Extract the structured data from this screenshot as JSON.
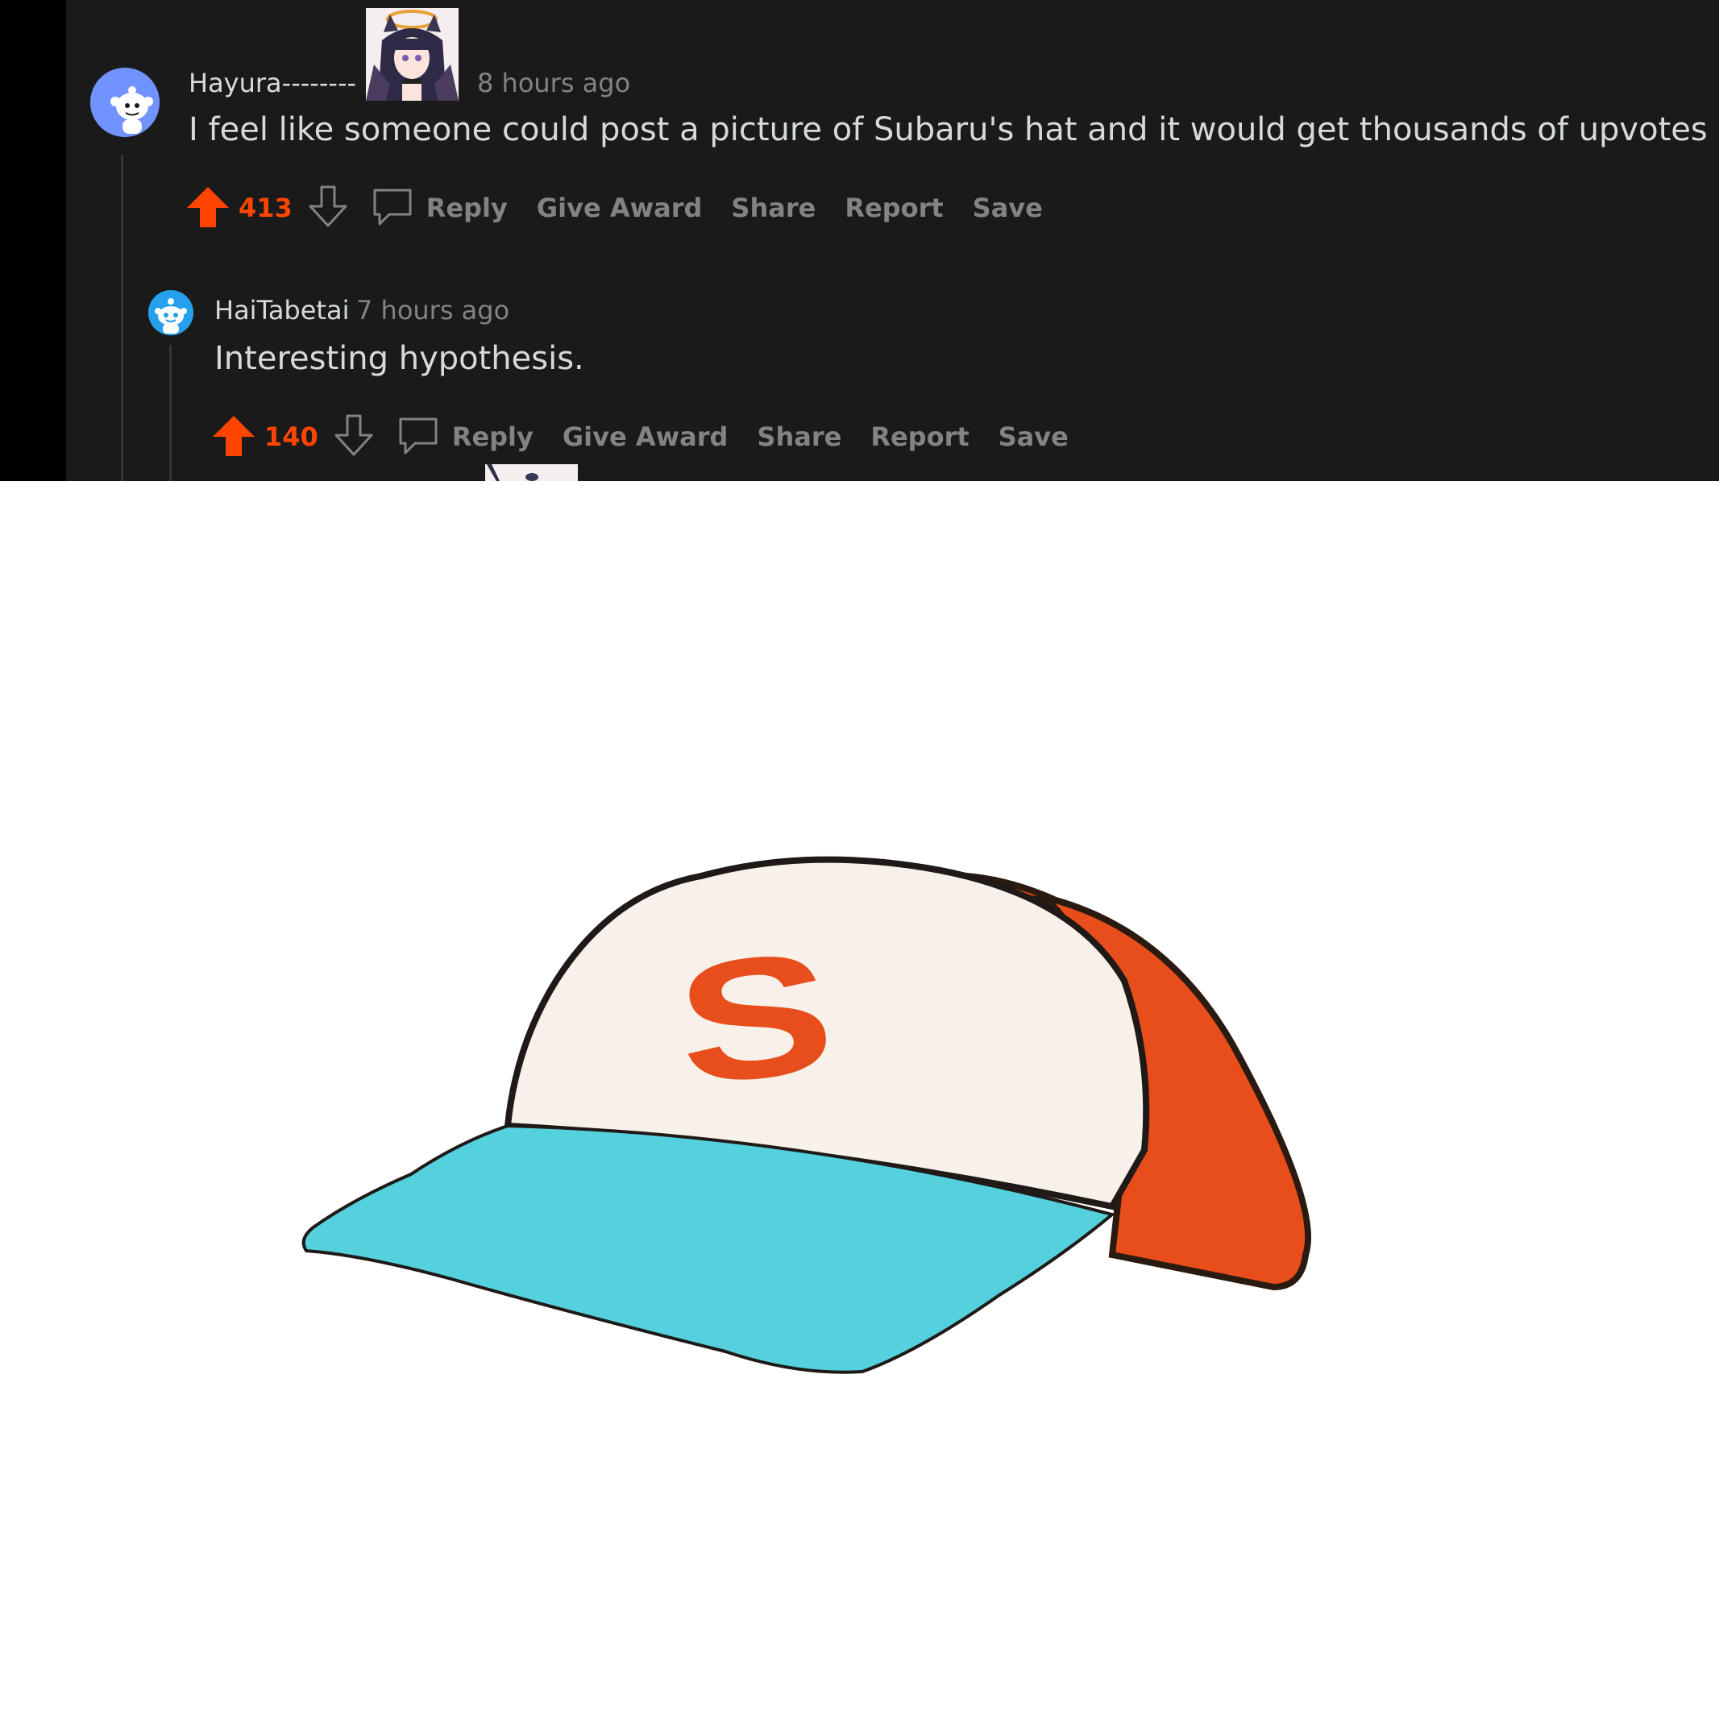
{
  "comments": [
    {
      "username": "Hayura--------",
      "time": "8 hours ago",
      "text": "I feel like someone could post a picture of Subaru's hat and it would get thousands of upvotes",
      "votes": "413",
      "actions": {
        "reply": "Reply",
        "award": "Give Award",
        "share": "Share",
        "report": "Report",
        "save": "Save"
      }
    },
    {
      "username": "HaiTabetai",
      "time": "7 hours ago",
      "text": "Interesting hypothesis.",
      "votes": "140",
      "actions": {
        "reply": "Reply",
        "award": "Give Award",
        "share": "Share",
        "report": "Report",
        "save": "Save"
      }
    }
  ],
  "hat_image": {
    "letter": "S"
  },
  "colors": {
    "background": "#1a1a1b",
    "upvote": "#ff4500",
    "muted": "#818384",
    "text": "#d7dadc",
    "hat_crown": "#f7f1e9",
    "hat_side": "#e84d1c",
    "hat_brim": "#55d1dd"
  }
}
